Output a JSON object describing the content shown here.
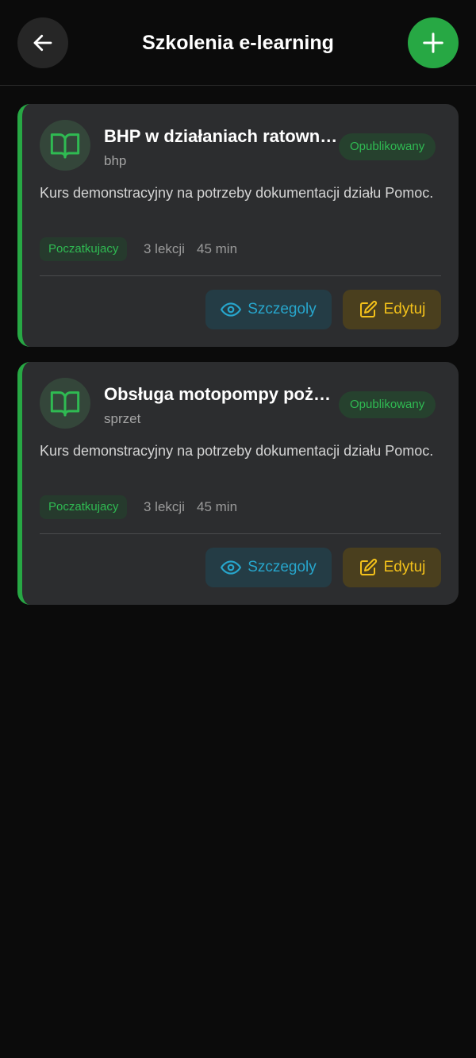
{
  "header": {
    "title": "Szkolenia e-learning",
    "back_icon": "arrow-left-icon",
    "add_icon": "plus-icon"
  },
  "colors": {
    "accent_green": "#27a844",
    "details_blue": "#27a6cc",
    "edit_yellow": "#f4c21a",
    "card_bg": "#2c2d2f",
    "page_bg": "#0b0b0b"
  },
  "courses": [
    {
      "icon": "book-open-icon",
      "title": "BHP w działaniach ratowni…",
      "category": "bhp",
      "status": "Opublikowany",
      "description": "Kurs demonstracyjny na potrzeby dokumentacji działu Pomoc.",
      "level": "Poczatkujacy",
      "lessons": "3 lekcji",
      "duration": "45 min",
      "details_label": "Szczegoly",
      "edit_label": "Edytuj"
    },
    {
      "icon": "book-open-icon",
      "title": "Obsługa motopompy poża…",
      "category": "sprzet",
      "status": "Opublikowany",
      "description": "Kurs demonstracyjny na potrzeby dokumentacji działu Pomoc.",
      "level": "Poczatkujacy",
      "lessons": "3 lekcji",
      "duration": "45 min",
      "details_label": "Szczegoly",
      "edit_label": "Edytuj"
    }
  ]
}
